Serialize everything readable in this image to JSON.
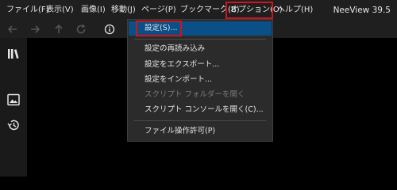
{
  "app": {
    "title": "NeeView 39.5"
  },
  "menubar": {
    "items": [
      {
        "label": "ファイル(F)"
      },
      {
        "label": "表示(V)"
      },
      {
        "label": "画像(I)"
      },
      {
        "label": "移動(J)"
      },
      {
        "label": "ページ(P)"
      },
      {
        "label": "ブックマーク(B)"
      },
      {
        "label": "オプション(O)"
      },
      {
        "label": "ヘルプ(H)"
      }
    ]
  },
  "options_menu": {
    "items": [
      {
        "label": "設定(S)...",
        "state": "selected"
      },
      {
        "label": "設定の再読み込み",
        "state": "normal"
      },
      {
        "label": "設定をエクスポート...",
        "state": "normal"
      },
      {
        "label": "設定をインポート...",
        "state": "normal"
      },
      {
        "label": "スクリプト フォルダーを開く",
        "state": "disabled"
      },
      {
        "label": "スクリプト コンソールを開く(C)...",
        "state": "normal"
      },
      {
        "label": "ファイル操作許可(P)",
        "state": "normal"
      }
    ]
  },
  "toolbar": {
    "icons": [
      "back-arrow-icon",
      "forward-arrow-icon",
      "up-arrow-icon",
      "refresh-icon",
      "info-icon"
    ]
  },
  "sidebar": {
    "icons": [
      "bookshelf-icon",
      "image-icon",
      "history-icon"
    ]
  },
  "colors": {
    "accent_highlight": "#d0141b",
    "selected_item": "#0a4f86"
  }
}
